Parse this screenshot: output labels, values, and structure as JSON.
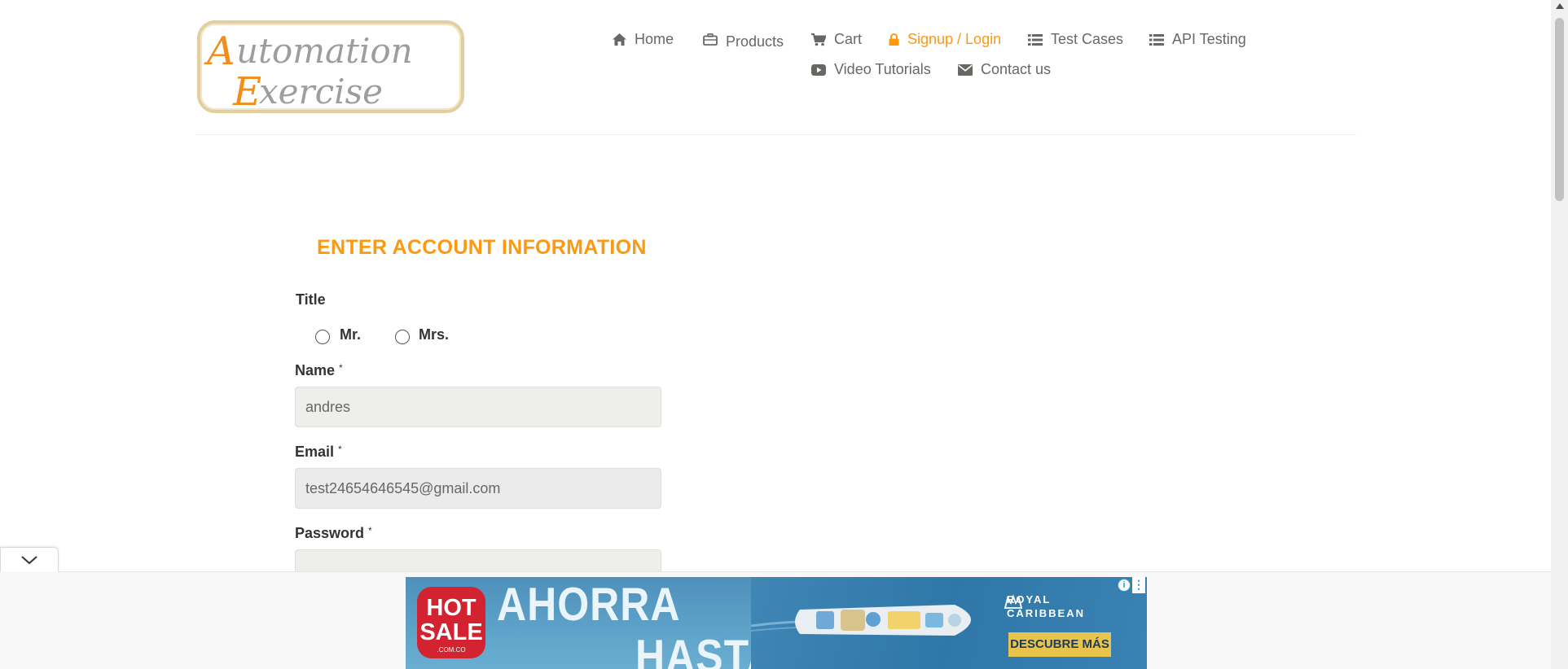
{
  "logo": {
    "line1": "Automation",
    "line2": "Exercise"
  },
  "nav": {
    "items": [
      {
        "label": "Home",
        "icon": "home-icon"
      },
      {
        "label": "Products",
        "icon": "briefcase-icon"
      },
      {
        "label": "Cart",
        "icon": "cart-icon"
      },
      {
        "label": "Signup / Login",
        "icon": "lock-icon",
        "active": true
      },
      {
        "label": "Test Cases",
        "icon": "list-icon"
      },
      {
        "label": "API Testing",
        "icon": "list-icon"
      },
      {
        "label": "Video Tutorials",
        "icon": "youtube-icon"
      },
      {
        "label": "Contact us",
        "icon": "envelope-icon"
      }
    ]
  },
  "form": {
    "heading": "ENTER ACCOUNT INFORMATION",
    "title_label": "Title",
    "title_options": [
      "Mr.",
      "Mrs."
    ],
    "name_label": "Name",
    "name_value": "andres",
    "email_label": "Email",
    "email_value": "test24654646545@gmail.com",
    "password_label": "Password",
    "password_value": "",
    "required_mark": "*"
  },
  "ad": {
    "badge_line1": "HOT",
    "badge_line2": "SALE",
    "badge_line3": ".COM.CO",
    "headline1": "AHORRA",
    "headline2": "HASTA",
    "brand_line1": "ROYAL",
    "brand_line2": "CARIBBEAN",
    "cta": "DESCUBRE MÁS",
    "info_icon": "i",
    "menu_icon": "⋮"
  },
  "colors": {
    "accent": "#fe980f",
    "nav_text": "#696763",
    "input_bg": "#eeeeea"
  }
}
